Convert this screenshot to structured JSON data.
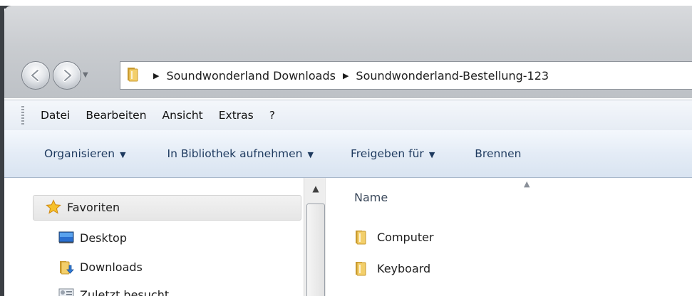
{
  "breadcrumb": {
    "items": [
      "Soundwonderland Downloads",
      "Soundwonderland-Bestellung-123"
    ]
  },
  "menubar": {
    "items": [
      "Datei",
      "Bearbeiten",
      "Ansicht",
      "Extras",
      "?"
    ]
  },
  "commandbar": {
    "organize": "Organisieren",
    "library": "In Bibliothek aufnehmen",
    "share": "Freigeben für",
    "burn": "Brennen"
  },
  "navpane": {
    "favorites": "Favoriten",
    "items": [
      "Desktop",
      "Downloads",
      "Zuletzt besucht"
    ]
  },
  "content": {
    "column_name": "Name",
    "files": [
      "Computer",
      "Keyboard"
    ]
  },
  "colors": {
    "folder": "#e8b948",
    "command_text": "#1e3a5f"
  }
}
